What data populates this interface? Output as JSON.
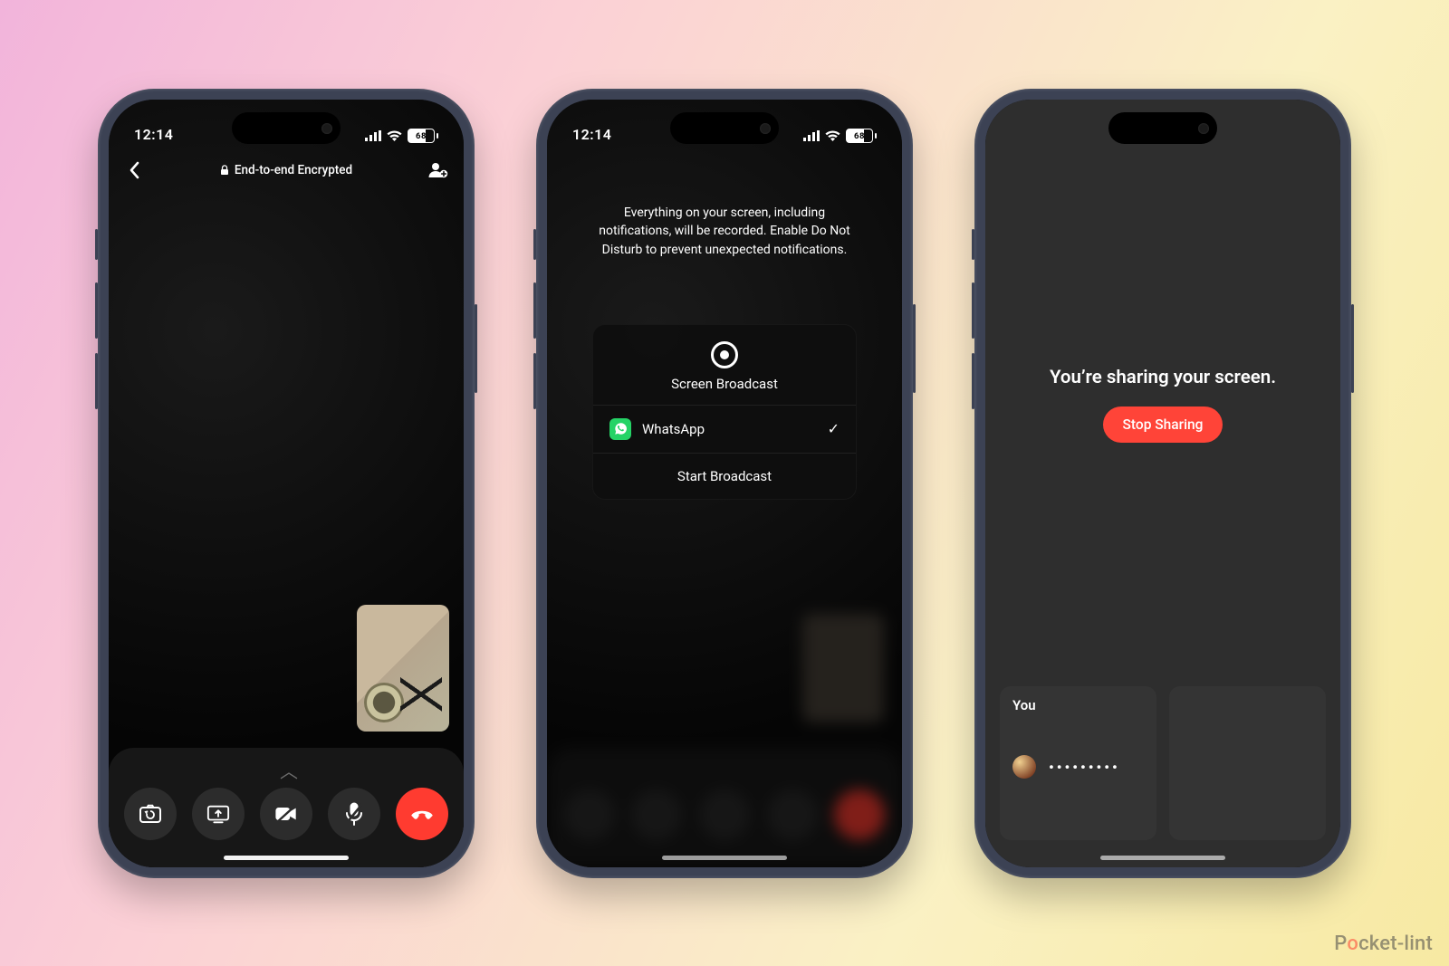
{
  "status": {
    "time": "12:14",
    "battery": "68"
  },
  "screen1": {
    "encryption_label": "End-to-end Encrypted"
  },
  "screen2": {
    "warning": "Everything on your screen, including notifications, will be recorded. Enable Do Not Disturb to prevent unexpected notifications.",
    "sheet_title": "Screen Broadcast",
    "app_name": "WhatsApp",
    "start_label": "Start Broadcast"
  },
  "screen3": {
    "headline": "You’re sharing your screen.",
    "stop_label": "Stop Sharing",
    "card1_label": "You",
    "card1_line": "•••••••••"
  },
  "watermark": {
    "a": "P",
    "b": "o",
    "c": "cket-lint"
  }
}
